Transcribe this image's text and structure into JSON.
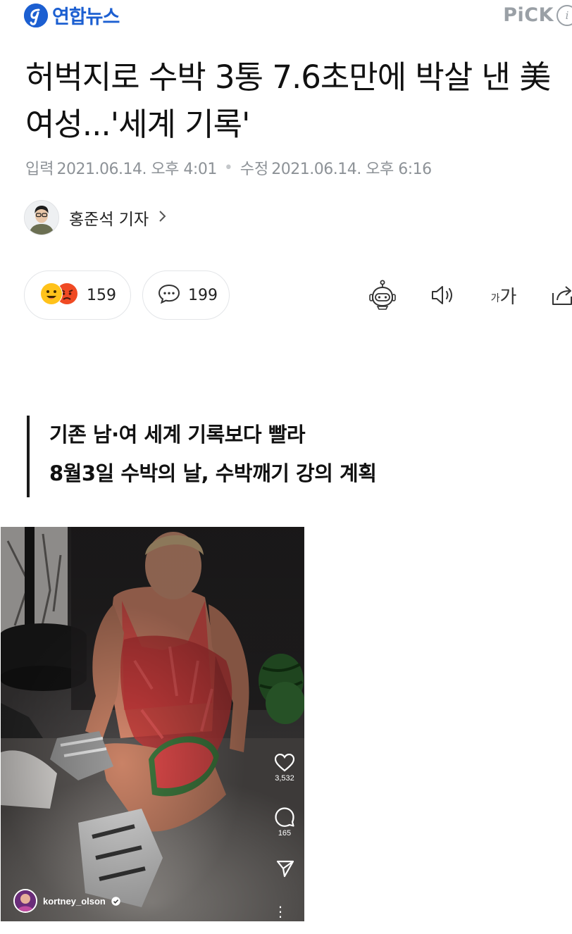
{
  "header": {
    "logo_text": "연합뉴스",
    "pick_label": "PiCK",
    "info_icon_glyph": "i",
    "brand_color": "#1c5fd1"
  },
  "article": {
    "title": "허벅지로 수박 3통 7.6초만에 박살 낸 美 여성...'세계 기록'",
    "input_label": "입력",
    "input_date": "2021.06.14. 오후 4:01",
    "modified_label": "수정",
    "modified_date": "2021.06.14. 오후 6:16",
    "reporter": "홍준석 기자"
  },
  "reactions": {
    "reaction_count": "159",
    "comment_count": "199"
  },
  "tools": {
    "summary_icon": "robot-summary-icon",
    "tts_icon": "speaker-icon",
    "font_size_icon": "font-size-icon",
    "font_size_small": "가",
    "font_size_large": "가",
    "share_icon": "share-icon"
  },
  "subtitle": {
    "line1": "기존 남·여 세계 기록보다 빨라",
    "line2": "8월3일 수박의 날, 수박깨기 강의 계획"
  },
  "photo": {
    "likes": "3,532",
    "comments": "165",
    "username": "kortney_olson"
  }
}
